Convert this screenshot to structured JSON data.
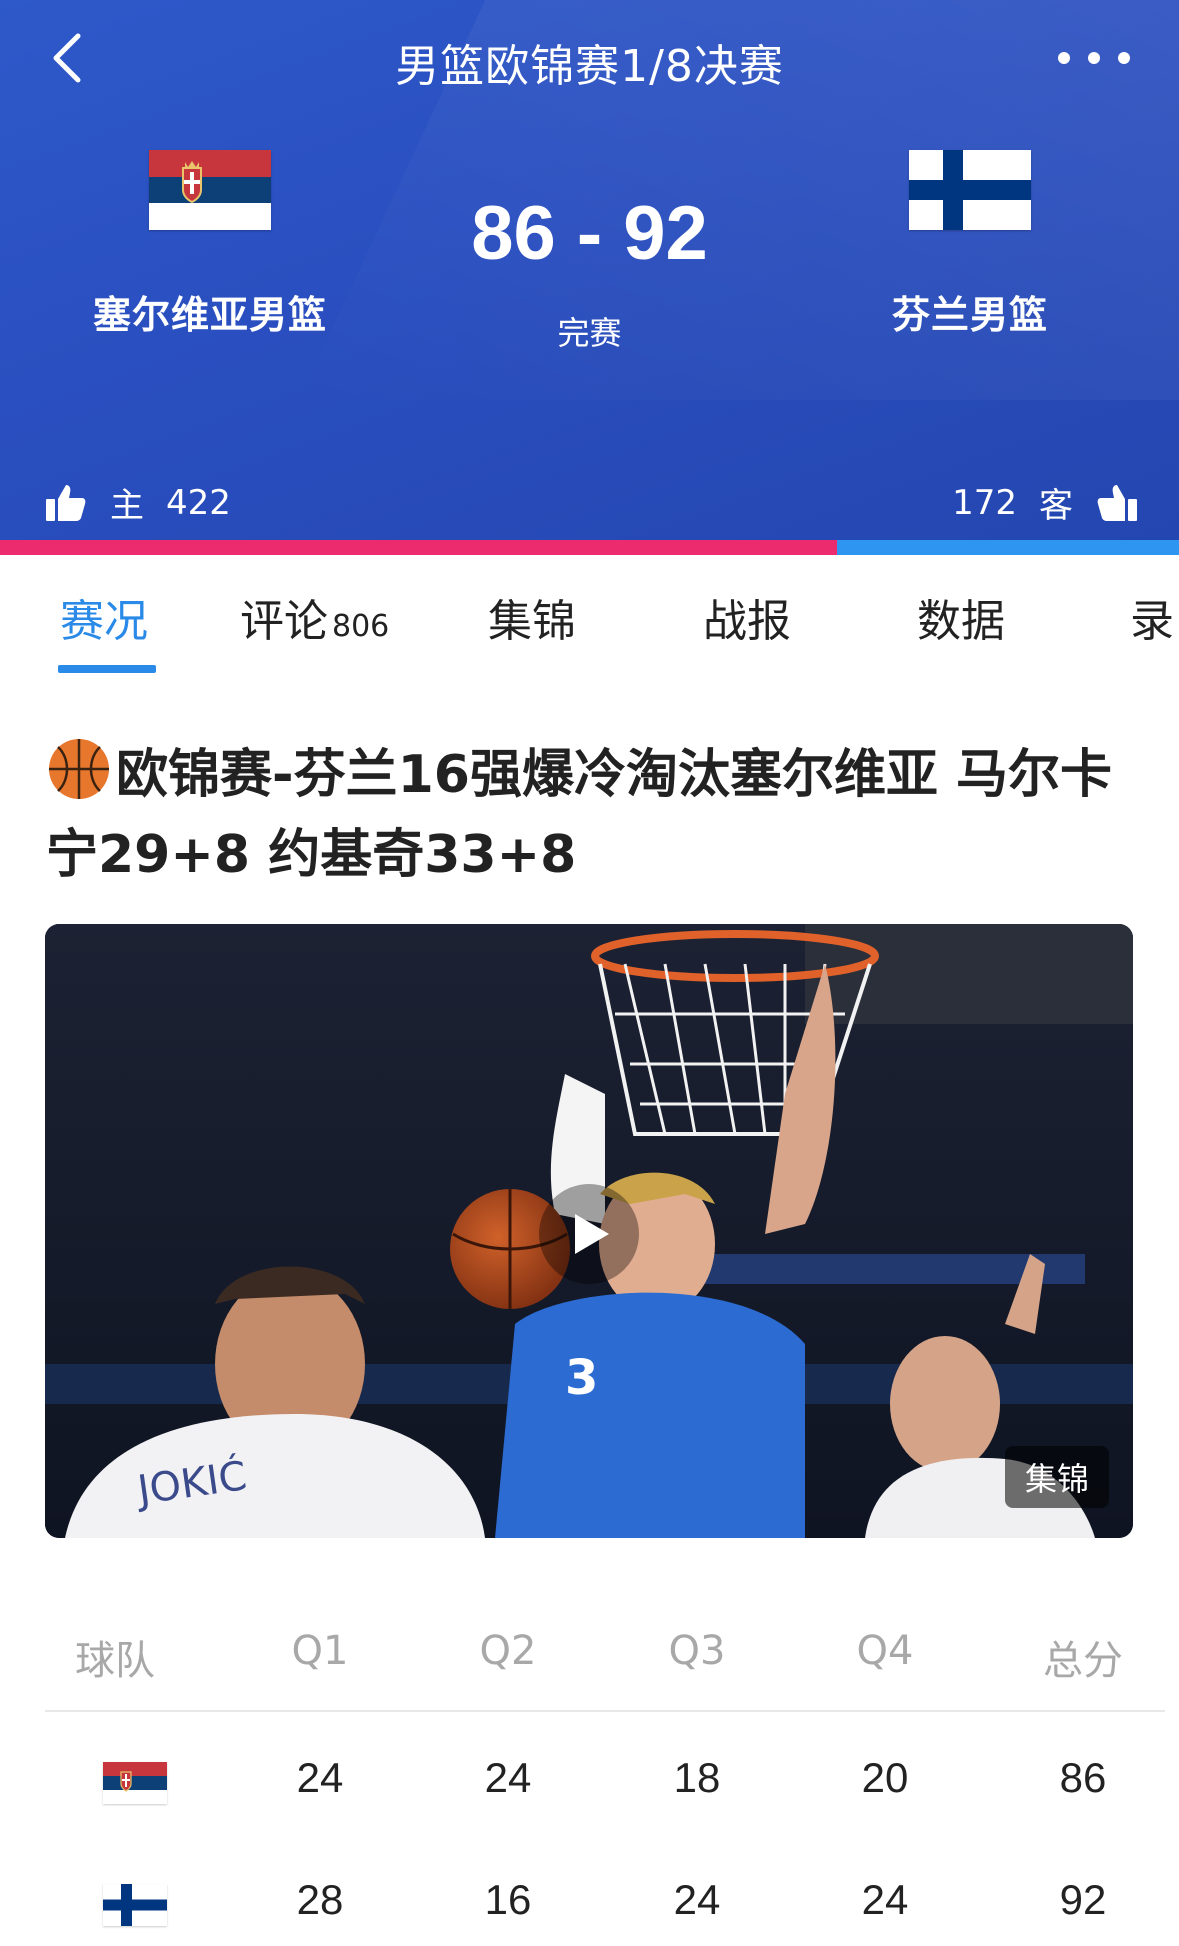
{
  "nav": {
    "title": "男篮欧锦赛1/8决赛"
  },
  "match": {
    "home": {
      "name": "塞尔维亚男篮",
      "flag": "serbia-flag"
    },
    "away": {
      "name": "芬兰男篮",
      "flag": "finland-flag"
    },
    "score": "86 - 92",
    "status": "完赛"
  },
  "support": {
    "home_label": "主",
    "home_count": "422",
    "away_label": "客",
    "away_count": "172",
    "home_fraction": 0.71,
    "home_color": "#ec2a6e",
    "away_color": "#2e96f0"
  },
  "tabs": [
    {
      "label": "赛况",
      "active": true
    },
    {
      "label": "评论",
      "count": "806"
    },
    {
      "label": "集锦"
    },
    {
      "label": "战报"
    },
    {
      "label": "数据"
    },
    {
      "label": "录"
    }
  ],
  "article": {
    "title": "欧锦赛-芬兰16强爆冷淘汰塞尔维亚 马尔卡宁29+8 约基奇33+8",
    "video_badge": "集锦"
  },
  "score_table": {
    "headers": [
      "球队",
      "Q1",
      "Q2",
      "Q3",
      "Q4",
      "总分"
    ],
    "rows": [
      {
        "team_flag": "serbia-flag",
        "q": [
          "24",
          "24",
          "18",
          "20"
        ],
        "total": "86"
      },
      {
        "team_flag": "finland-flag",
        "q": [
          "28",
          "16",
          "24",
          "24"
        ],
        "total": "92"
      }
    ]
  },
  "colors": {
    "header_blue": "#2a4fc0",
    "accent_blue": "#2a8ae8"
  }
}
